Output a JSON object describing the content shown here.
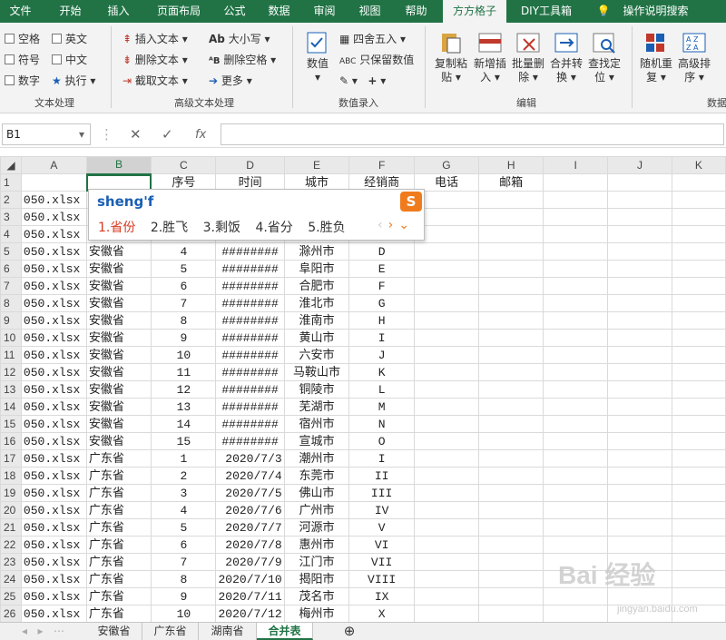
{
  "tabs": [
    "文件",
    "开始",
    "插入",
    "页面布局",
    "公式",
    "数据",
    "审阅",
    "视图",
    "帮助",
    "方方格子",
    "DIY工具箱",
    "操作说明搜索"
  ],
  "ribbon": {
    "text_proc": {
      "items": [
        "空格",
        "英文",
        "符号",
        "中文",
        "数字",
        "执行"
      ],
      "label": "文本处理"
    },
    "adv_text": {
      "items": [
        "插入文本",
        "删除文本",
        "截取文本",
        "大小写",
        "删除空格",
        "更多"
      ],
      "label": "高级文本处理"
    },
    "num_input": {
      "num_label": "数值",
      "round": "四舍五入",
      "keep_num": "只保留数值",
      "label": "数值录入"
    },
    "edit": {
      "items": [
        "复制粘贴",
        "新增插入",
        "批量删除",
        "合并转换",
        "查找定位"
      ],
      "label": "编辑"
    },
    "data": {
      "items": [
        "随机重复",
        "高级排序"
      ],
      "label": "数据"
    }
  },
  "namebox": "B1",
  "fx": "fx",
  "col_headers": [
    "A",
    "B",
    "C",
    "D",
    "E",
    "F",
    "G",
    "H",
    "I",
    "J",
    "K"
  ],
  "ime": {
    "pinyin": "sheng'f",
    "candidates": [
      "1.省份",
      "2.胜飞",
      "3.剩饭",
      "4.省分",
      "5.胜负"
    ],
    "logo": "S"
  },
  "rows": [
    [
      "1",
      "",
      "",
      "序号",
      "时间",
      "城市",
      "经销商",
      "电话",
      "邮箱",
      "",
      "",
      ""
    ],
    [
      "2",
      "050.xlsx",
      "",
      "",
      "",
      "",
      "",
      "",
      "",
      "",
      "",
      ""
    ],
    [
      "3",
      "050.xlsx",
      "",
      "",
      "",
      "",
      "",
      "",
      "",
      "",
      "",
      ""
    ],
    [
      "4",
      "050.xlsx",
      "",
      "",
      "",
      "",
      "",
      "",
      "",
      "",
      "",
      ""
    ],
    [
      "5",
      "050.xlsx",
      "安徽省",
      "4",
      "########",
      "滁州市",
      "D",
      "",
      "",
      "",
      "",
      ""
    ],
    [
      "6",
      "050.xlsx",
      "安徽省",
      "5",
      "########",
      "阜阳市",
      "E",
      "",
      "",
      "",
      "",
      ""
    ],
    [
      "7",
      "050.xlsx",
      "安徽省",
      "6",
      "########",
      "合肥市",
      "F",
      "",
      "",
      "",
      "",
      ""
    ],
    [
      "8",
      "050.xlsx",
      "安徽省",
      "7",
      "########",
      "淮北市",
      "G",
      "",
      "",
      "",
      "",
      ""
    ],
    [
      "9",
      "050.xlsx",
      "安徽省",
      "8",
      "########",
      "淮南市",
      "H",
      "",
      "",
      "",
      "",
      ""
    ],
    [
      "10",
      "050.xlsx",
      "安徽省",
      "9",
      "########",
      "黄山市",
      "I",
      "",
      "",
      "",
      "",
      ""
    ],
    [
      "11",
      "050.xlsx",
      "安徽省",
      "10",
      "########",
      "六安市",
      "J",
      "",
      "",
      "",
      "",
      ""
    ],
    [
      "12",
      "050.xlsx",
      "安徽省",
      "11",
      "########",
      "马鞍山市",
      "K",
      "",
      "",
      "",
      "",
      ""
    ],
    [
      "13",
      "050.xlsx",
      "安徽省",
      "12",
      "########",
      "铜陵市",
      "L",
      "",
      "",
      "",
      "",
      ""
    ],
    [
      "14",
      "050.xlsx",
      "安徽省",
      "13",
      "########",
      "芜湖市",
      "M",
      "",
      "",
      "",
      "",
      ""
    ],
    [
      "15",
      "050.xlsx",
      "安徽省",
      "14",
      "########",
      "宿州市",
      "N",
      "",
      "",
      "",
      "",
      ""
    ],
    [
      "16",
      "050.xlsx",
      "安徽省",
      "15",
      "########",
      "宣城市",
      "O",
      "",
      "",
      "",
      "",
      ""
    ],
    [
      "17",
      "050.xlsx",
      "广东省",
      "1",
      "2020/7/3",
      "潮州市",
      "I",
      "",
      "",
      "",
      "",
      ""
    ],
    [
      "18",
      "050.xlsx",
      "广东省",
      "2",
      "2020/7/4",
      "东莞市",
      "II",
      "",
      "",
      "",
      "",
      ""
    ],
    [
      "19",
      "050.xlsx",
      "广东省",
      "3",
      "2020/7/5",
      "佛山市",
      "III",
      "",
      "",
      "",
      "",
      ""
    ],
    [
      "20",
      "050.xlsx",
      "广东省",
      "4",
      "2020/7/6",
      "广州市",
      "IV",
      "",
      "",
      "",
      "",
      ""
    ],
    [
      "21",
      "050.xlsx",
      "广东省",
      "5",
      "2020/7/7",
      "河源市",
      "V",
      "",
      "",
      "",
      "",
      ""
    ],
    [
      "22",
      "050.xlsx",
      "广东省",
      "6",
      "2020/7/8",
      "惠州市",
      "VI",
      "",
      "",
      "",
      "",
      ""
    ],
    [
      "23",
      "050.xlsx",
      "广东省",
      "7",
      "2020/7/9",
      "江门市",
      "VII",
      "",
      "",
      "",
      "",
      ""
    ],
    [
      "24",
      "050.xlsx",
      "广东省",
      "8",
      "2020/7/10",
      "揭阳市",
      "VIII",
      "",
      "",
      "",
      "",
      ""
    ],
    [
      "25",
      "050.xlsx",
      "广东省",
      "9",
      "2020/7/11",
      "茂名市",
      "IX",
      "",
      "",
      "",
      "",
      ""
    ],
    [
      "26",
      "050.xlsx",
      "广东省",
      "10",
      "2020/7/12",
      "梅州市",
      "X",
      "",
      "",
      "",
      "",
      ""
    ]
  ],
  "sheets": [
    "安徽省",
    "广东省",
    "湖南省",
    "合并表"
  ],
  "watermark": {
    "brand": "Bai 经验",
    "url": "jingyan.baidu.com"
  }
}
